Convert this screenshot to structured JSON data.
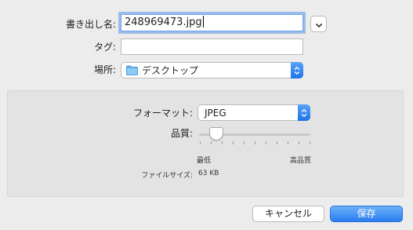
{
  "dialog": {
    "export_as_label": "書き出し名:",
    "filename_value": "248969473.jpg",
    "tags_label": "タグ:",
    "tags_value": "",
    "where_label": "場所:",
    "where_value": "デスクトップ",
    "format_label": "フォーマット:",
    "format_value": "JPEG",
    "quality_label": "品質:",
    "quality_level": 0.15,
    "quality_min_label": "最低",
    "quality_max_label": "高品質",
    "filesize_label": "ファイルサイズ:",
    "filesize_value": "63 KB",
    "cancel_label": "キャンセル",
    "save_label": "保存"
  },
  "icons": {
    "expand": "chevron-down-icon",
    "folder": "folder-icon",
    "stepper": "up-down-chevron-icon"
  },
  "colors": {
    "accent": "#2a7df0",
    "focus_ring": "#6ea4e8",
    "background": "#ececec",
    "folder": "#5fb0ec"
  }
}
